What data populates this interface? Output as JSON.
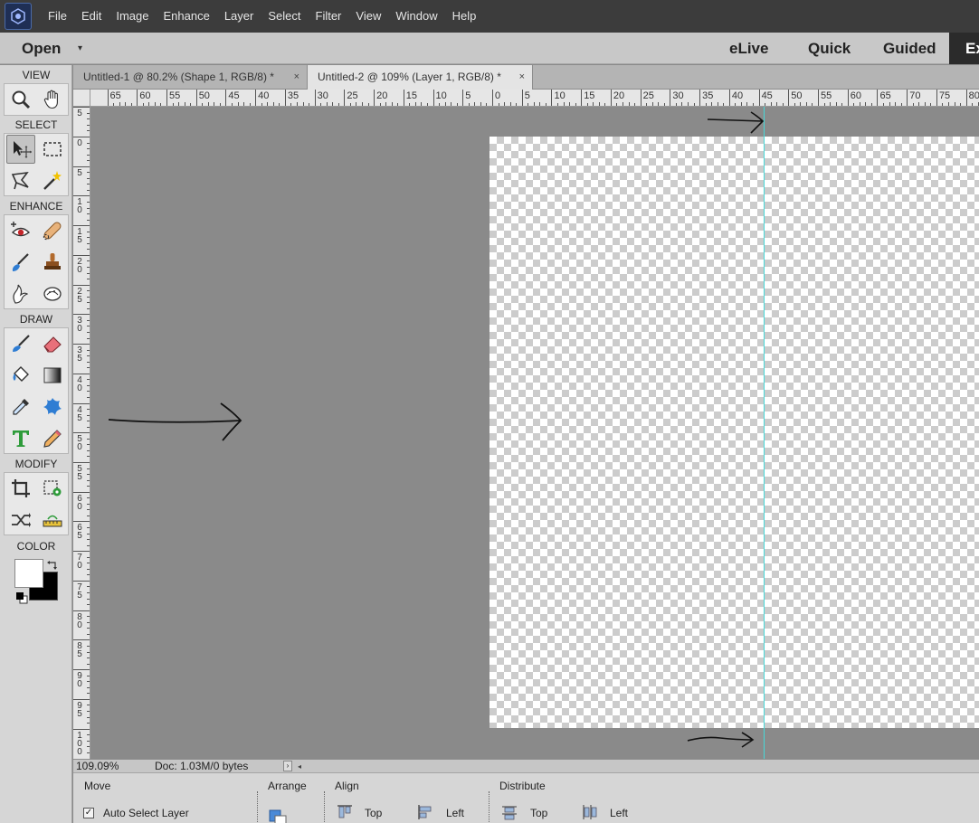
{
  "menu": [
    "File",
    "Edit",
    "Image",
    "Enhance",
    "Layer",
    "Select",
    "Filter",
    "View",
    "Window",
    "Help"
  ],
  "modebar": {
    "open_label": "Open",
    "open_caret": "▾",
    "tabs": [
      "eLive",
      "Quick",
      "Guided",
      "Ex"
    ]
  },
  "toolbox": {
    "sections": [
      "VIEW",
      "SELECT",
      "ENHANCE",
      "DRAW",
      "MODIFY",
      "COLOR"
    ],
    "foreground_color": "#ffffff",
    "background_color": "#000000"
  },
  "documents": [
    {
      "title": "Untitled-1 @ 80.2% (Shape 1, RGB/8) *",
      "close": "×"
    },
    {
      "title": "Untitled-2 @ 109% (Layer 1, RGB/8) *",
      "close": "×"
    }
  ],
  "rulers": {
    "horizontal": [
      "65",
      "60",
      "55",
      "50",
      "45",
      "40",
      "35",
      "30",
      "25",
      "20",
      "15",
      "10",
      "5",
      "0",
      "5",
      "10",
      "15",
      "20",
      "25",
      "30",
      "35",
      "40",
      "45",
      "50",
      "55",
      "60",
      "65",
      "70",
      "75",
      "80"
    ],
    "vertical": [
      [
        "5"
      ],
      [
        "0"
      ],
      [
        "5"
      ],
      [
        "1",
        "0"
      ],
      [
        "1",
        "5"
      ],
      [
        "2",
        "0"
      ],
      [
        "2",
        "5"
      ],
      [
        "3",
        "0"
      ],
      [
        "3",
        "5"
      ],
      [
        "4",
        "0"
      ],
      [
        "4",
        "5"
      ],
      [
        "5",
        "0"
      ],
      [
        "5",
        "5"
      ],
      [
        "6",
        "0"
      ],
      [
        "6",
        "5"
      ],
      [
        "7",
        "0"
      ],
      [
        "7",
        "5"
      ],
      [
        "8",
        "0"
      ],
      [
        "8",
        "5"
      ],
      [
        "9",
        "0"
      ],
      [
        "9",
        "5"
      ],
      [
        "1",
        "0",
        "0"
      ]
    ]
  },
  "colors": {
    "guide": "#47d8d8",
    "app_accent": "#4a6aa8"
  },
  "status": {
    "zoom": "109.09%",
    "doc_info": "Doc: 1.03M/0 bytes",
    "arrow": "›",
    "scroll_left": "◂"
  },
  "options": {
    "move_title": "Move",
    "auto_select_label": "Auto Select Layer",
    "auto_select_checked": "✓",
    "arrange_title": "Arrange",
    "align_title": "Align",
    "align_top": "Top",
    "align_left": "Left",
    "distribute_title": "Distribute",
    "distribute_top": "Top",
    "distribute_left": "Left"
  }
}
